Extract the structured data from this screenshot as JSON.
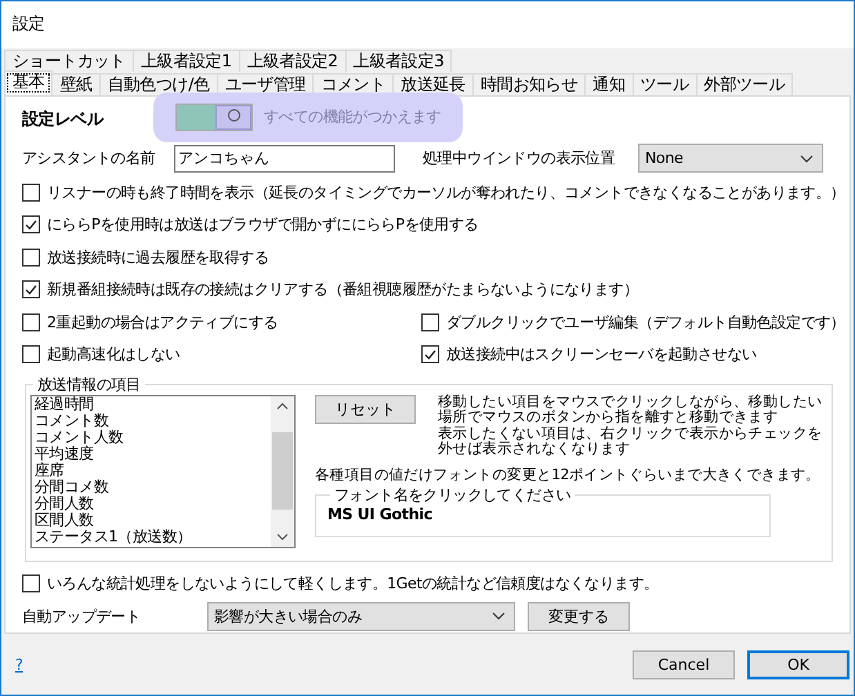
{
  "window": {
    "title": "設定"
  },
  "tab_rows": [
    [
      {
        "label": "ショートカット",
        "selected": false
      },
      {
        "label": "上級者設定1",
        "selected": false
      },
      {
        "label": "上級者設定2",
        "selected": false
      },
      {
        "label": "上級者設定3",
        "selected": false
      }
    ],
    [
      {
        "label": "基本",
        "selected": true
      },
      {
        "label": "壁紙",
        "selected": false
      },
      {
        "label": "自動色つけ/色",
        "selected": false
      },
      {
        "label": "ユーザ管理",
        "selected": false
      },
      {
        "label": "コメント",
        "selected": false
      },
      {
        "label": "放送延長",
        "selected": false
      },
      {
        "label": "時間お知らせ",
        "selected": false
      },
      {
        "label": "通知",
        "selected": false
      },
      {
        "label": "ツール",
        "selected": false
      },
      {
        "label": "外部ツール",
        "selected": false
      }
    ]
  ],
  "level_setting": {
    "label": "設定レベル",
    "on": true,
    "description": "すべての機能がつかえます"
  },
  "assistant_name": {
    "label": "アシスタントの名前",
    "value": "アンコちゃん"
  },
  "window_position": {
    "label": "処理中ウインドウの表示位置",
    "value": "None"
  },
  "option_rows": [
    [
      {
        "label": "リスナーの時も終了時間を表示（延長のタイミングでカーソルが奪われたり、コメントできなくなることがあります。）",
        "checked": false
      }
    ],
    [
      {
        "label": "にららPを使用時は放送はブラウザで開かずににららPを使用する",
        "checked": true
      }
    ],
    [
      {
        "label": "放送接続時に過去履歴を取得する",
        "checked": false
      }
    ],
    [
      {
        "label": "新規番組接続時は既存の接続はクリアする（番組視聴履歴がたまらないようになります）",
        "checked": true
      }
    ],
    [
      {
        "label": "2重起動の場合はアクティブにする",
        "checked": false
      },
      {
        "label": "ダブルクリックでユーザ編集（デフォルト自動色設定です）",
        "checked": false
      }
    ],
    [
      {
        "label": "起動高速化はしない",
        "checked": false
      },
      {
        "label": "放送接続中はスクリーンセーバを起動させない",
        "checked": true
      }
    ]
  ],
  "broadcast_items": {
    "title": "放送情報の項目",
    "items": [
      "経過時間",
      "コメント数",
      "コメント人数",
      "平均速度",
      "座席",
      "分間コメ数",
      "分間人数",
      "区間人数",
      "ステータス1（放送数）"
    ],
    "reset_button": "リセット",
    "help_lines": [
      "移動したい項目をマウスでクリックしながら、移動したい",
      "場所でマウスのボタンから指を離すと移動できます",
      "表示したくない項目は、右クリックで表示からチェックを",
      "外せば表示されなくなります"
    ],
    "font_note": "各種項目の値だけフォントの変更と12ポイントぐらいまで大きくできます。",
    "font_group_title": "フォント名をクリックしてください",
    "font_name": "MS UI Gothic"
  },
  "light_mode": {
    "label": "いろんな統計処理をしないようにして軽くします。1Getの統計など信頼度はなくなります。",
    "checked": false
  },
  "auto_update": {
    "label": "自動アップデート",
    "value": "影響が大きい場合のみ",
    "button": "変更する"
  },
  "footer": {
    "help_link": "?",
    "buttons": [
      {
        "label": "Cancel",
        "default": false
      },
      {
        "label": "OK",
        "default": true
      }
    ]
  }
}
